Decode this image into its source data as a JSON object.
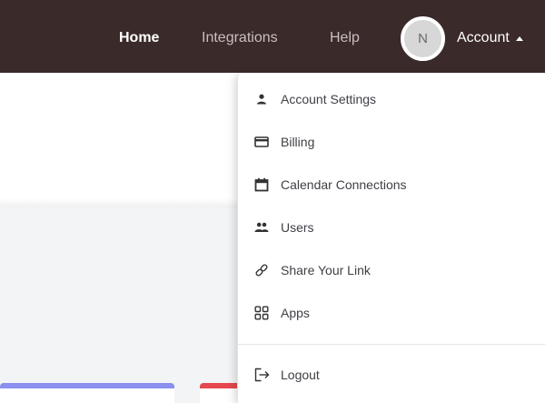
{
  "nav": {
    "home": "Home",
    "integrations": "Integrations",
    "help": "Help",
    "avatar_initial": "N",
    "account": "Account"
  },
  "colors": {
    "topbar": "#3b2a2a",
    "card_blue": "#8a8ff0",
    "card_red": "#e5484d"
  },
  "account_menu": {
    "items": [
      {
        "label": "Account Settings",
        "icon": "person-icon"
      },
      {
        "label": "Billing",
        "icon": "credit-card-icon"
      },
      {
        "label": "Calendar Connections",
        "icon": "calendar-icon"
      },
      {
        "label": "Users",
        "icon": "users-icon"
      },
      {
        "label": "Share Your Link",
        "icon": "link-icon"
      },
      {
        "label": "Apps",
        "icon": "apps-grid-icon"
      }
    ],
    "logout": {
      "label": "Logout",
      "icon": "logout-icon"
    }
  }
}
